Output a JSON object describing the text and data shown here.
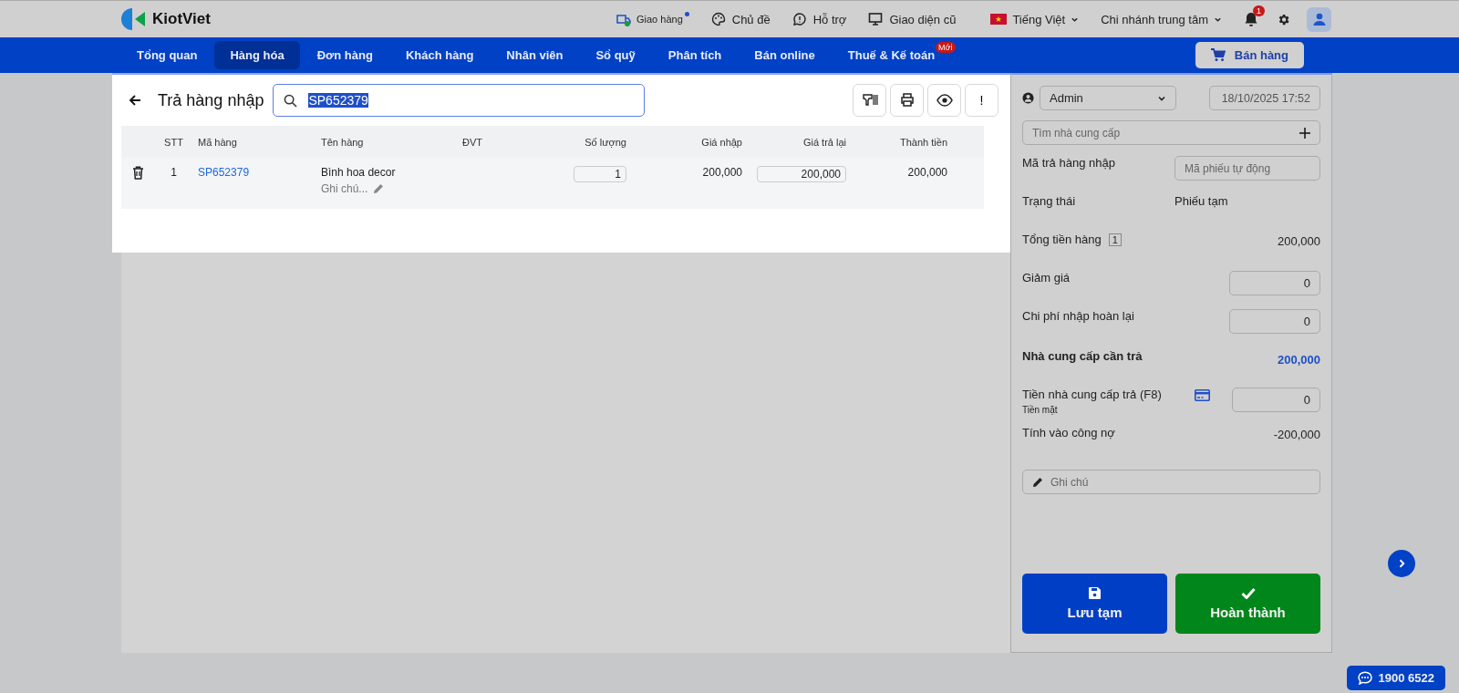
{
  "header": {
    "logo": "KiotViet",
    "links": [
      {
        "kind": "delivery",
        "label": "Giao hàng",
        "dot": true
      },
      {
        "kind": "theme",
        "label": "Chủ đề",
        "dot": false
      },
      {
        "kind": "support",
        "label": "Hỗ trợ",
        "dot": false
      },
      {
        "kind": "monitor",
        "label": "Giao diện cũ",
        "dot": false
      }
    ],
    "language": "Tiếng Việt",
    "branch": "Chi nhánh trung tâm",
    "notification_count": "1"
  },
  "nav": {
    "tabs": [
      {
        "label": "Tổng quan",
        "selected": false
      },
      {
        "label": "Hàng hóa",
        "selected": true
      },
      {
        "label": "Đơn hàng",
        "selected": false
      },
      {
        "label": "Khách hàng",
        "selected": false
      },
      {
        "label": "Nhân viên",
        "selected": false
      },
      {
        "label": "Sổ quỹ",
        "selected": false
      },
      {
        "label": "Phân tích",
        "selected": false
      },
      {
        "label": "Bán online",
        "selected": false
      },
      {
        "label": "Thuế & Kế toán",
        "selected": false,
        "badge": "Mới"
      }
    ],
    "sell_button": "Bán hàng"
  },
  "page": {
    "title": "Trả hàng nhập",
    "search": {
      "value": "SP652379",
      "selected": true
    },
    "tools": [
      {
        "kind": "barcode"
      },
      {
        "kind": "print"
      },
      {
        "kind": "eye"
      },
      {
        "kind": "text",
        "label": "!"
      }
    ]
  },
  "table": {
    "columns": [
      "STT",
      "Mã hàng",
      "Tên hàng",
      "ĐVT",
      "Số lượng",
      "Giá nhập",
      "Giá trả lại",
      "Thành tiền"
    ],
    "rows": [
      {
        "stt": "1",
        "code": "SP652379",
        "name": "Bình hoa decor",
        "note": "Ghi chú...",
        "unit": "",
        "quantity": "1",
        "price": "200,000",
        "return_price": "200,000",
        "total": "200,000"
      }
    ]
  },
  "side": {
    "user": "Admin",
    "date": "18/10/2025 17:52",
    "supplier_placeholder": "Tìm nhà cung cấp",
    "rows": [
      {
        "kind": "input",
        "label": "Mã trả hàng nhập",
        "placeholder": "Mã phiếu tự động"
      },
      {
        "kind": "text",
        "label": "Trạng thái",
        "value": "Phiếu tạm"
      },
      {
        "kind": "total",
        "label": "Tổng tiền hàng",
        "count": "1",
        "value": "200,000"
      },
      {
        "kind": "number",
        "label": "Giảm giá",
        "value": "0"
      },
      {
        "kind": "number",
        "label": "Chi phí nhập hoàn lại",
        "value": "0"
      },
      {
        "kind": "strong",
        "label": "Nhà cung cấp cần trả",
        "value": "200,000"
      },
      {
        "kind": "payment",
        "label": "Tiền nhà cung cấp trả (F8)",
        "sub": "Tiền mặt",
        "value": "0"
      },
      {
        "kind": "amount",
        "label": "Tính vào công nợ",
        "value": "-200,000"
      }
    ],
    "note_placeholder": "Ghi chú",
    "save_button": "Lưu tạm",
    "done_button": "Hoàn thành"
  },
  "hotline": "1900 6522"
}
